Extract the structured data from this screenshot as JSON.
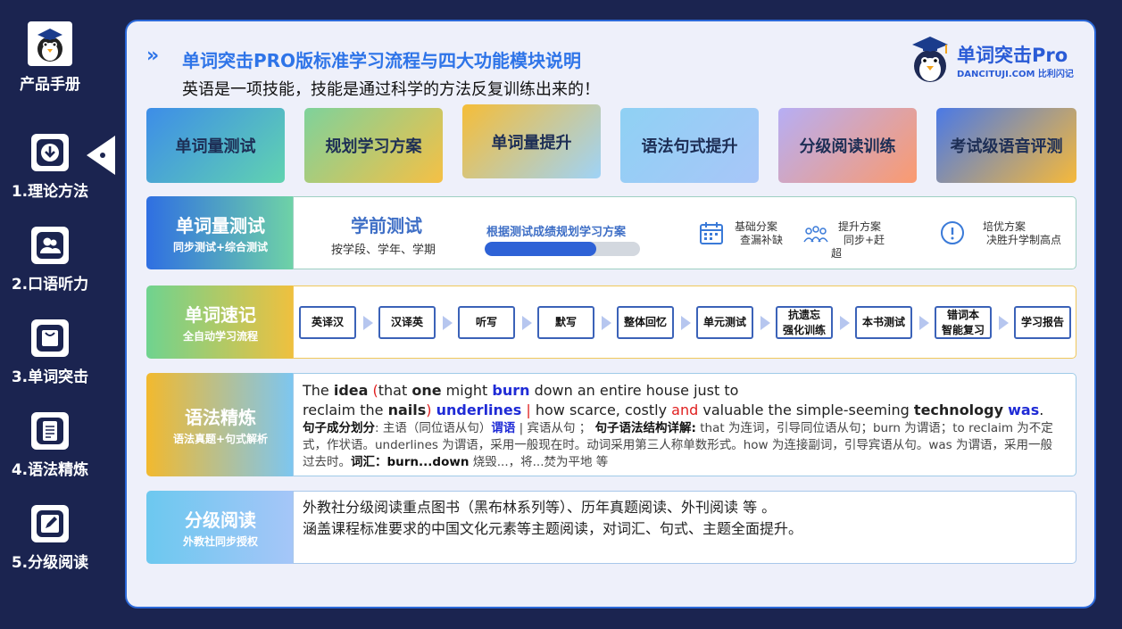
{
  "sidebar": {
    "manual_label": "产品手册",
    "items": [
      {
        "label": "1.理论方法",
        "icon": "download-icon"
      },
      {
        "label": "2.口语听力",
        "icon": "user-icon"
      },
      {
        "label": "3.单词突击",
        "icon": "bag-icon"
      },
      {
        "label": "4.语法精炼",
        "icon": "document-icon"
      },
      {
        "label": "5.分级阅读",
        "icon": "edit-icon"
      }
    ]
  },
  "header": {
    "arrows": "»",
    "title": "单词突击PRO版标准学习流程与四大功能模块说明",
    "subtitle": "英语是一项技能，技能是通过科学的方法反复训练出来的！"
  },
  "brand": {
    "name": "单词突击Pro",
    "sub": "DANCITUJI.COM 比利闪记"
  },
  "cards": [
    {
      "label": "单词量测试"
    },
    {
      "label": "规划学习方案"
    },
    {
      "label": "单词量提升"
    },
    {
      "label": "语法句式提升"
    },
    {
      "label": "分级阅读训练"
    },
    {
      "label": "考试级语音评测"
    }
  ],
  "row1": {
    "title": "单词量测试",
    "subtitle": "同步测试+综合测试",
    "pre_title": "学前测试",
    "pre_sub": "按学段、学年、学期",
    "plan_title": "根据测试成绩规划学习方案",
    "progress": 0.72,
    "features": [
      {
        "line1": "基础分案",
        "line2": "查漏补缺",
        "icon": "calendar-icon"
      },
      {
        "line1": "提升方案",
        "line2": "同步+赶",
        "line3": "超",
        "icon": "team-icon"
      },
      {
        "line1": "培优方案",
        "line2": "决胜升学制高点",
        "icon": "alert-icon"
      }
    ]
  },
  "row2": {
    "title": "单词速记",
    "subtitle": "全自动学习流程",
    "steps": [
      {
        "l1": "英译汉"
      },
      {
        "l1": "汉译英"
      },
      {
        "l1": "听写"
      },
      {
        "l1": "默写"
      },
      {
        "l1": "整体回忆"
      },
      {
        "l1": "单元测试"
      },
      {
        "l1": "抗遗忘",
        "l2": "强化训练"
      },
      {
        "l1": "本书测试"
      },
      {
        "l1": "错词本",
        "l2": "智能复习"
      },
      {
        "l1": "学习报告"
      }
    ]
  },
  "row3": {
    "title": "语法精炼",
    "subtitle": "语法真题+句式解析",
    "s": {
      "a1": "The ",
      "idea": "idea",
      "a2": " (",
      "that": "that",
      "a3": " ",
      "one": "one",
      "a4": " might ",
      "burn": "burn",
      "a5": " down an entire house just to",
      "a6": "reclaim the ",
      "nails": "nails",
      "a7": ") ",
      "underlines": "underlines",
      "bar1": " | ",
      "a8": "how scarce, costly ",
      "and": "and",
      "a9": " valuable the simple-seeming ",
      "technology": "technology",
      "a10": " ",
      "was": "was",
      "a11": "."
    },
    "analysis": {
      "k1": "句子成分划分",
      "t1": ": 主语（同位语从句）",
      "k2": "谓语",
      "t2": " | 宾语从句 ； ",
      "k3": "句子语法结构详解:",
      "t3": " that 为连词，引导同位语从句；burn 为谓语；to reclaim 为不定式，作状语。underlines 为谓语，采用一般现在时。动词采用第三人称单数形式。how 为连接副词，引导宾语从句。was 为谓语，采用一般过去时。",
      "k4": "词汇：burn...down",
      "t4": "  烧毁...，将...焚为平地  等"
    }
  },
  "row4": {
    "title": "分级阅读",
    "subtitle": "外教社同步授权",
    "line1": "外教社分级阅读重点图书（黑布林系列等）、历年真题阅读、外刊阅读 等 。",
    "line2": "涵盖课程标准要求的中国文化元素等主题阅读，对词汇、句式、主题全面提升。"
  }
}
